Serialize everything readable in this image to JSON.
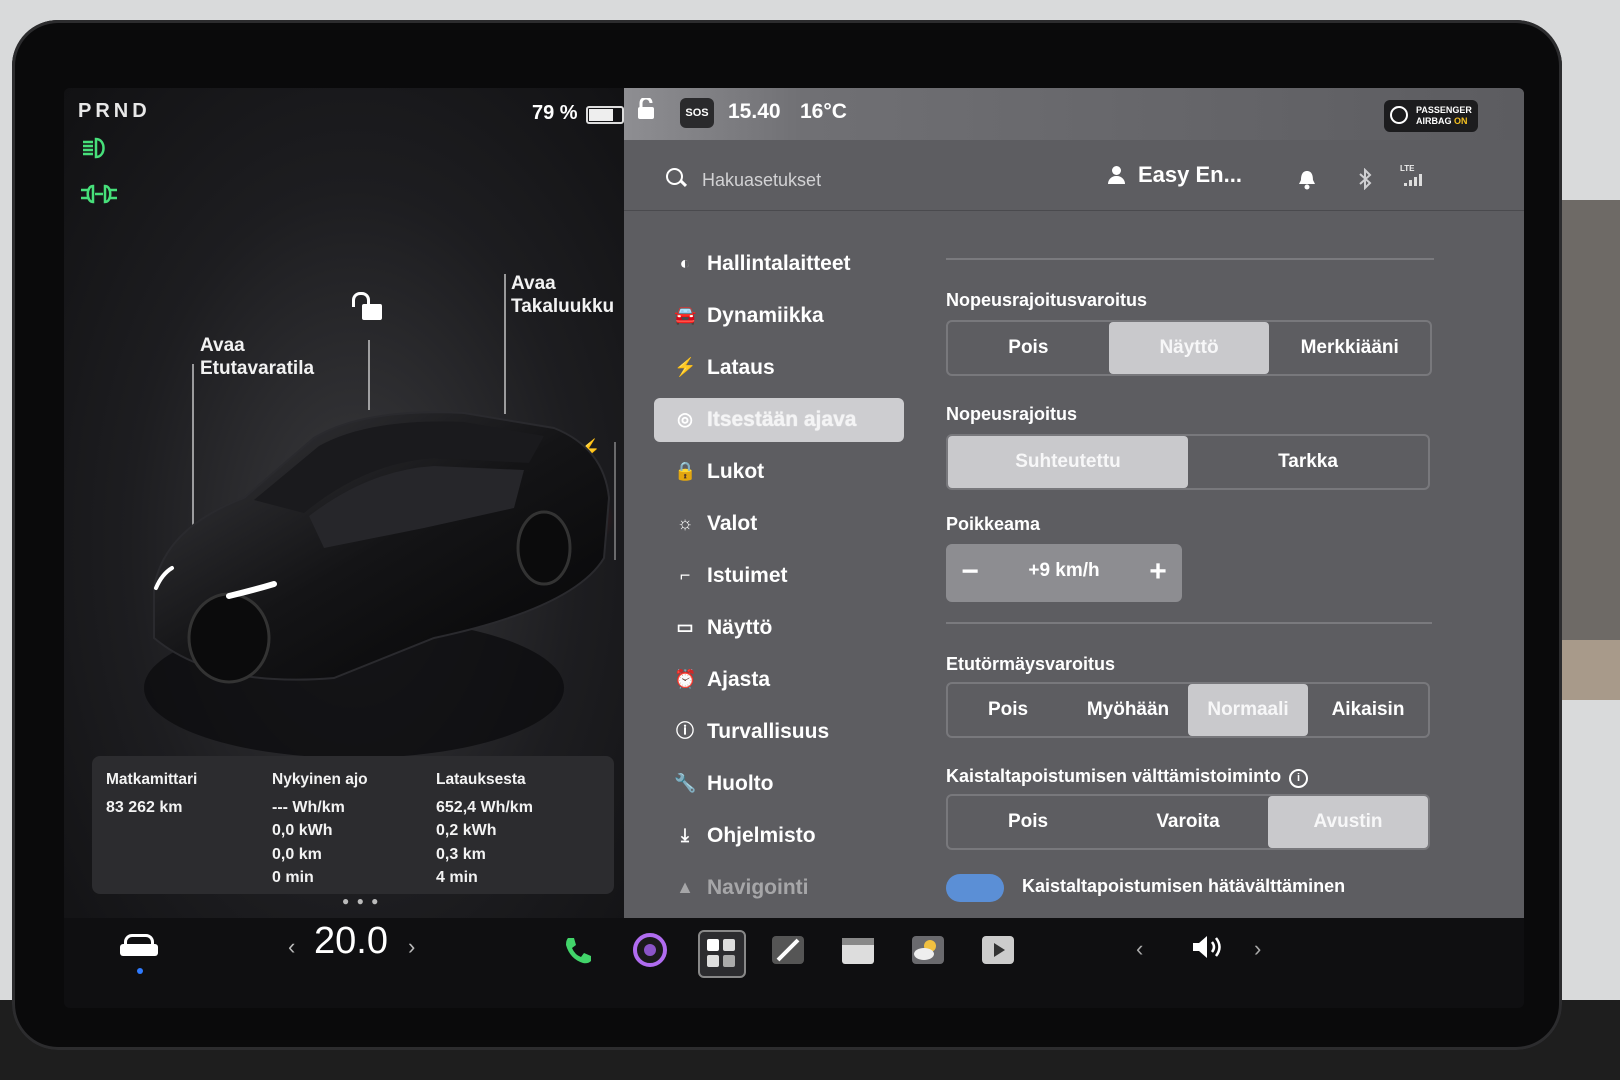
{
  "gear": "PRND",
  "battery": {
    "percent_label": "79 %",
    "level": 0.79
  },
  "callouts": {
    "frunk": "Avaa\nEtutavaratila",
    "trunk": "Avaa\nTakaluukku"
  },
  "trip": {
    "odometer": {
      "header": "Matkamittari",
      "values": [
        "83 262 km"
      ]
    },
    "current": {
      "header": "Nykyinen ajo",
      "values": [
        "--- Wh/km",
        "0,0 kWh",
        "0,0 km",
        "0 min"
      ]
    },
    "since_charge": {
      "header": "Latauksesta",
      "values": [
        "652,4 Wh/km",
        "0,2 kWh",
        "0,3 km",
        "4 min"
      ]
    }
  },
  "status_bar": {
    "sos": "SOS",
    "time": "15.40",
    "temperature": "16°C",
    "airbag_line1": "PASSENGER",
    "airbag_line2": "AIRBAG",
    "airbag_state": "ON"
  },
  "search": {
    "placeholder": "Hakuasetukset"
  },
  "profile": {
    "name": "Easy En..."
  },
  "lte": "LTE",
  "nav": [
    {
      "label": "Hallintalaitteet",
      "icon": "toggle-icon"
    },
    {
      "label": "Dynamiikka",
      "icon": "car-icon"
    },
    {
      "label": "Lataus",
      "icon": "bolt-icon"
    },
    {
      "label": "Itsestään ajava",
      "icon": "steering-wheel-icon",
      "active": true
    },
    {
      "label": "Lukot",
      "icon": "lock-icon"
    },
    {
      "label": "Valot",
      "icon": "sun-icon"
    },
    {
      "label": "Istuimet",
      "icon": "seat-icon"
    },
    {
      "label": "Näyttö",
      "icon": "display-icon"
    },
    {
      "label": "Ajasta",
      "icon": "alarm-clock-icon"
    },
    {
      "label": "Turvallisuus",
      "icon": "info-circle-icon"
    },
    {
      "label": "Huolto",
      "icon": "wrench-icon"
    },
    {
      "label": "Ohjelmisto",
      "icon": "download-icon"
    },
    {
      "label": "Navigointi",
      "icon": "navigation-arrow-icon"
    }
  ],
  "settings": {
    "speed_limit_warning": {
      "title": "Nopeusrajoitusvaroitus",
      "options": [
        "Pois",
        "Näyttö",
        "Merkkiääni"
      ],
      "selected": 1
    },
    "speed_limit": {
      "title": "Nopeusrajoitus",
      "options": [
        "Suhteutettu",
        "Tarkka"
      ],
      "selected": 0
    },
    "offset": {
      "title": "Poikkeama",
      "value": "+9 km/h",
      "minus": "−",
      "plus": "+"
    },
    "forward_collision": {
      "title": "Etutörmäysvaroitus",
      "options": [
        "Pois",
        "Myöhään",
        "Normaali",
        "Aikaisin"
      ],
      "selected": 2
    },
    "lane_departure": {
      "title": "Kaistaltapoistumisen välttämistoiminto",
      "info": "i",
      "options": [
        "Pois",
        "Varoita",
        "Avustin"
      ],
      "selected": 2
    },
    "emergency_lane": {
      "title": "Kaistaltapoistumisen hätävälttäminen",
      "enabled": true
    }
  },
  "dock": {
    "temperature": "20.0",
    "temp_left": "‹",
    "temp_right": "›",
    "media_left": "‹",
    "media_right": "›"
  }
}
